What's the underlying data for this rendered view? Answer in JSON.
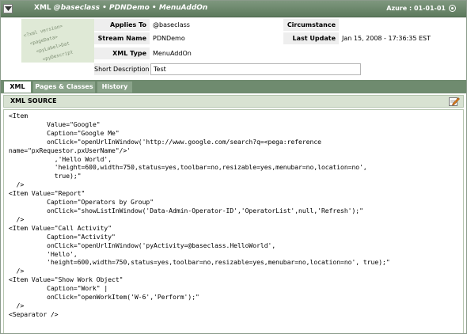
{
  "title_bar": {
    "prefix": "XML",
    "class_name": "@baseclass",
    "separator": "•",
    "ruleset": "PDNDemo",
    "rule_name": "MenuAddOn",
    "version": "Azure : 01-01-01"
  },
  "watermark_lines": [
    "<?xml version=",
    "<pageData>",
    "<pyLabel>Dat",
    "<pyDescript"
  ],
  "header": {
    "applies_to_label": "Applies To",
    "applies_to_value": "@baseclass",
    "stream_name_label": "Stream Name",
    "stream_name_value": "PDNDemo",
    "xml_type_label": "XML Type",
    "xml_type_value": "MenuAddOn",
    "short_description_label": "Short Description",
    "short_description_value": "Test",
    "circumstance_label": "Circumstance",
    "circumstance_value": "",
    "last_update_label": "Last Update",
    "last_update_value": "Jan 15, 2008 - 17:36:35 EST"
  },
  "tabs": [
    {
      "label": "XML",
      "active": true
    },
    {
      "label": "Pages & Classes",
      "active": false
    },
    {
      "label": "History",
      "active": false
    }
  ],
  "section": {
    "title": "XML SOURCE"
  },
  "xml_source": "<Item\n          Value=\"Google\"\n          Caption=\"Google Me\"\n          onClick=\"openUrlInWindow('http://www.google.com/search?q=<pega:reference\nname=\"pxRequestor.pxUserName\"/>'\n            ,'Hello World',\n            'height=600,width=750,status=yes,toolbar=no,resizable=yes,menubar=no,location=no',\n            true);\"\n  />\n<Item Value=\"Report\"\n          Caption=\"Operators by Group\"\n          onClick=\"showListInWindow('Data-Admin-Operator-ID','OperatorList',null,'Refresh');\"\n  />\n<Item Value=\"Call Activity\"\n          Caption=\"Activity\"\n          onClick=\"openUrlInWindow('pyActivity=@baseclass.HelloWorld',\n          'Hello',\n          'height=600,width=750,status=yes,toolbar=no,resizable=yes,menubar=no,location=no', true);\"\n  />\n<Item Value=\"Show Work Object\"\n          Caption=\"Work\" |\n          onClick=\"openWorkItem('W-6','Perform');\"\n  />\n<Separator />",
  "icons": {
    "collapse": "collapse-arrow-icon",
    "target": "target-icon",
    "edit": "edit-icon"
  },
  "colors": {
    "title_bar": "#6a856a",
    "tab_active": "#ffffff",
    "tab_inactive": "#8aa38a",
    "section_header": "#d8e2d2",
    "label_bg": "#eeeeee"
  }
}
